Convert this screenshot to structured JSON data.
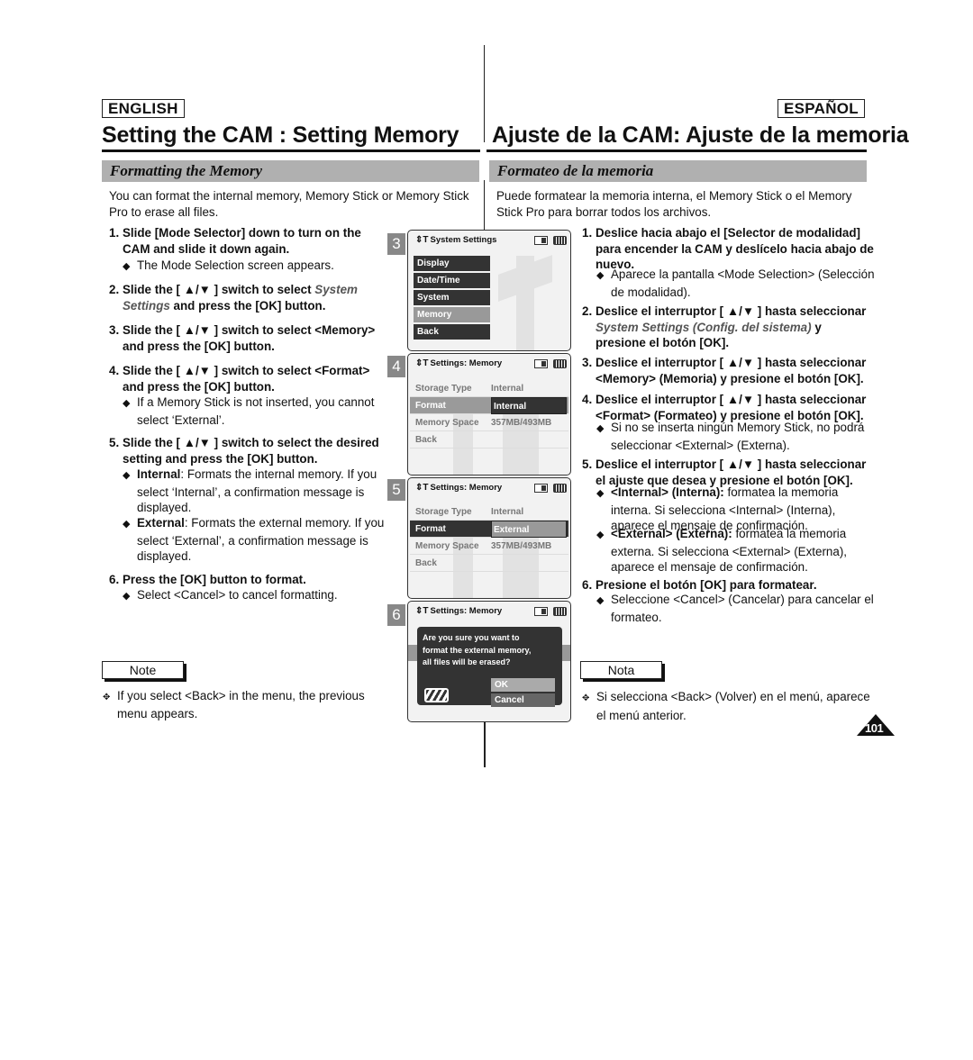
{
  "page_number": "101",
  "english": {
    "lang_label": "ENGLISH",
    "title": "Setting the CAM : Setting Memory",
    "section": "Formatting the Memory",
    "intro": "You can format the internal memory, Memory Stick or Memory Stick Pro to erase all files.",
    "steps": [
      {
        "num": "1.",
        "text": "Slide [Mode Selector] down to turn on the CAM and slide it down again.",
        "bullets": [
          "The Mode Selection screen appears."
        ]
      },
      {
        "num": "2.",
        "text_pre": "Slide the [ ▲/▼ ] switch to select ",
        "text_italic": "System Settings",
        "text_post": " and press the [OK] button."
      },
      {
        "num": "3.",
        "text": "Slide the [ ▲/▼ ] switch to select <Memory> and press the [OK] button."
      },
      {
        "num": "4.",
        "text": "Slide the [ ▲/▼ ] switch to select <Format> and press the [OK] button.",
        "bullets": [
          "If a Memory Stick is not inserted, you cannot select ‘External’."
        ]
      },
      {
        "num": "5.",
        "text": "Slide the [ ▲/▼ ] switch to select the desired setting and press the [OK] button.",
        "bullets": [
          {
            "bold": "Internal",
            "text": ": Formats the internal memory. If you select  ‘Internal’, a confirmation message is displayed."
          },
          {
            "bold": "External",
            "text": ": Formats the external memory. If you select ‘External’, a confirmation message is displayed."
          }
        ]
      },
      {
        "num": "6.",
        "text": "Press the [OK] button to format.",
        "bullets": [
          "Select <Cancel> to cancel formatting."
        ]
      }
    ],
    "note_label": "Note",
    "note_text": "If you select <Back> in the menu, the previous menu appears."
  },
  "espanol": {
    "lang_label": "ESPAÑOL",
    "title": "Ajuste de la CAM: Ajuste de la memoria",
    "section": "Formateo de la memoria",
    "intro": "Puede formatear la memoria interna, el Memory Stick o el Memory Stick Pro para borrar todos los archivos.",
    "steps": [
      {
        "num": "1.",
        "text": "Deslice hacia abajo el [Selector de modalidad] para encender la CAM y deslícelo hacia abajo de nuevo.",
        "bullets": [
          "Aparece la pantalla <Mode Selection> (Selección de modalidad)."
        ]
      },
      {
        "num": "2.",
        "text_pre": "Deslice el interruptor [ ▲/▼ ] hasta seleccionar ",
        "text_italic": "System Settings (Config. del sistema)",
        "text_post": " y presione el botón [OK]."
      },
      {
        "num": "3.",
        "text": "Deslice el interruptor [ ▲/▼ ] hasta seleccionar <Memory> (Memoria) y presione el botón [OK]."
      },
      {
        "num": "4.",
        "text": "Deslice el interruptor [ ▲/▼ ] hasta seleccionar <Format> (Formateo) y presione el botón [OK].",
        "bullets": [
          "Si no se inserta ningún Memory Stick, no podrá seleccionar <External> (Externa)."
        ]
      },
      {
        "num": "5.",
        "text": "Deslice el interruptor [ ▲/▼ ] hasta seleccionar el ajuste que desea y presione el botón [OK].",
        "bullets": [
          {
            "bold": "<Internal> (Interna):",
            "text": " formatea la memoria interna. Si selecciona <Internal> (Interna), aparece el mensaje de confirmación."
          },
          {
            "bold": "<External> (Externa):",
            "text": " formatea la memoria externa. Si selecciona <External> (Externa), aparece el mensaje de confirmación."
          }
        ]
      },
      {
        "num": "6.",
        "text": "Presione el botón [OK] para formatear.",
        "bullets": [
          "Seleccione <Cancel> (Cancelar) para cancelar el formateo."
        ]
      }
    ],
    "note_label": "Nota",
    "note_text": "Si selecciona <Back> (Volver) en el menú, aparece el menú anterior."
  },
  "screens": [
    {
      "step": "3",
      "title": "System Settings",
      "menu": [
        "Display",
        "Date/Time",
        "System",
        "Memory",
        "Back"
      ],
      "selected": "Memory"
    },
    {
      "step": "4",
      "title": "Settings: Memory",
      "rows": [
        {
          "label": "Storage Type",
          "value": "Internal"
        },
        {
          "label": "Format",
          "value": "Internal"
        },
        {
          "label": "Memory Space",
          "value": "357MB/493MB"
        },
        {
          "label": "Back",
          "value": ""
        }
      ]
    },
    {
      "step": "5",
      "title": "Settings: Memory",
      "rows": [
        {
          "label": "Storage Type",
          "value": "Internal"
        },
        {
          "label": "Format",
          "value": "External"
        },
        {
          "label": "Memory Space",
          "value": "357MB/493MB"
        },
        {
          "label": "Back",
          "value": ""
        }
      ]
    },
    {
      "step": "6",
      "title": "Settings: Memory",
      "dialog": {
        "message": [
          "Are you sure you want to",
          "format the external memory,",
          "all files will be erased?"
        ],
        "ok": "OK",
        "cancel": "Cancel"
      }
    }
  ]
}
